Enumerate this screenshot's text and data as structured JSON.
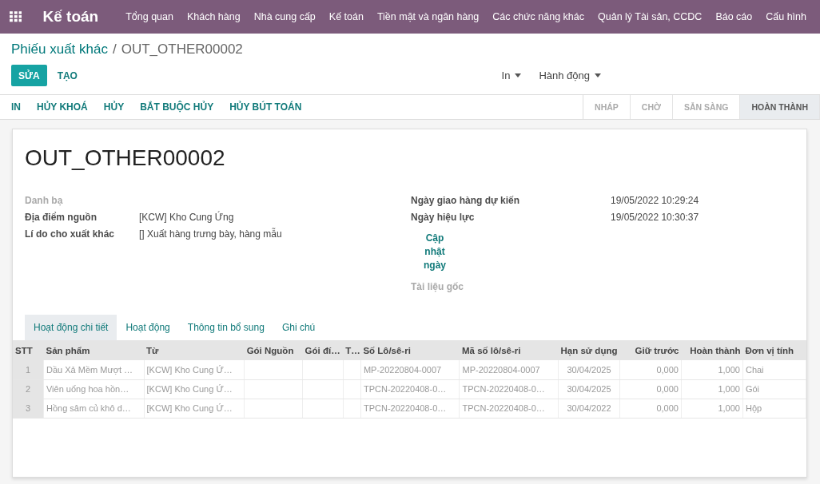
{
  "navbar": {
    "app_title": "Kế toán",
    "menu": [
      "Tổng quan",
      "Khách hàng",
      "Nhà cung cấp",
      "Kế toán",
      "Tiền mặt và ngân hàng",
      "Các chức năng khác",
      "Quản lý Tài sản, CCDC",
      "Báo cáo",
      "Cấu hình"
    ]
  },
  "breadcrumb": {
    "parent": "Phiếu xuất khác",
    "separator": "/",
    "current": "OUT_OTHER00002"
  },
  "buttons": {
    "primary": "SỬA",
    "secondary": "TẠO"
  },
  "dropdowns": [
    "In",
    "Hành động"
  ],
  "actions": [
    "IN",
    "HỦY KHOÁ",
    "HỦY",
    "BẮT BUỘC HỦY",
    "HỦY BÚT TOÁN"
  ],
  "status_steps": [
    {
      "label": "NHÁP",
      "selected": false
    },
    {
      "label": "CHỜ",
      "selected": false
    },
    {
      "label": "SẴN SÀNG",
      "selected": false
    },
    {
      "label": "HOÀN THÀNH",
      "selected": true
    }
  ],
  "record_title": "OUT_OTHER00002",
  "left_fields": [
    {
      "label": "Danh bạ"
    },
    {
      "label": "Địa điểm nguồn",
      "value": "[KCW] Kho Cung Ứng"
    },
    {
      "label": "Lí do cho xuất khác",
      "value": "[] Xuất hàng trưng bày, hàng mẫu"
    }
  ],
  "right_fields": [
    {
      "label": "Ngày giao hàng dự kiến",
      "value": "19/05/2022 10:29:24"
    },
    {
      "label": "Ngày hiệu lực",
      "value": "19/05/2022 10:30:37"
    }
  ],
  "update_link": "Cập nhật ngày",
  "source_doc": {
    "label": "Tài liệu gốc"
  },
  "tabs": [
    {
      "label": "Hoạt động chi tiết",
      "selected": true
    },
    {
      "label": "Hoạt động",
      "selected": false
    },
    {
      "label": "Thông tin bổ sung",
      "selected": false
    },
    {
      "label": "Ghi chú",
      "selected": false
    }
  ],
  "table": {
    "columns": [
      "STT",
      "Sản phẩm",
      "Từ",
      "Gói Nguồn",
      "Gói đí…",
      "T…",
      "Số Lô/sê-ri",
      "Mã số lô/sê-ri",
      "Hạn sử dụng",
      "Giữ trước",
      "Hoàn thành",
      "Đơn vị tính"
    ],
    "rows": [
      [
        "1",
        "Dầu Xả Mềm Mượt …",
        "[KCW] Kho Cung Ứ…",
        "",
        "",
        "",
        "MP-20220804-0007",
        "MP-20220804-0007",
        "30/04/2025",
        "0,000",
        "1,000",
        "Chai"
      ],
      [
        "2",
        "Viên uống hoa hồn…",
        "[KCW] Kho Cung Ứ…",
        "",
        "",
        "",
        "TPCN-20220408-0…",
        "TPCN-20220408-0…",
        "30/04/2025",
        "0,000",
        "1,000",
        "Gói"
      ],
      [
        "3",
        "Hồng sâm củ khô d…",
        "[KCW] Kho Cung Ứ…",
        "",
        "",
        "",
        "TPCN-20220408-0…",
        "TPCN-20220408-0…",
        "30/04/2022",
        "0,000",
        "1,000",
        "Hộp"
      ]
    ]
  }
}
